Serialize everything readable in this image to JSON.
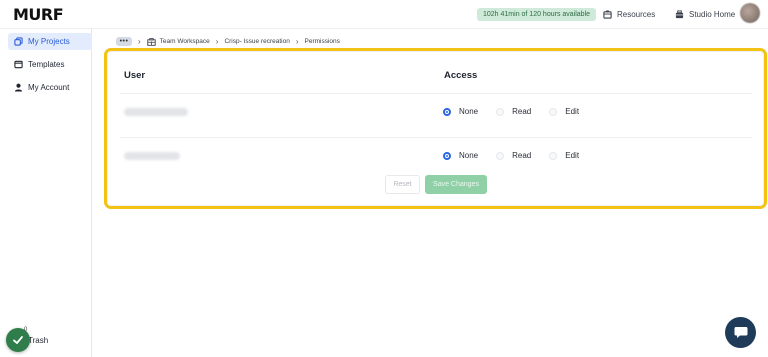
{
  "header": {
    "logo": "MURF",
    "hours_badge": "102h 41min of 120 hours available",
    "resources_label": "Resources",
    "studio_home_label": "Studio Home"
  },
  "sidebar": {
    "items": [
      {
        "label": "My Projects",
        "icon": "projects-icon",
        "active": true
      },
      {
        "label": "Templates",
        "icon": "templates-icon",
        "active": false
      },
      {
        "label": "My Account",
        "icon": "account-icon",
        "active": false
      }
    ],
    "trash_label": "Trash",
    "toast_count": "0"
  },
  "breadcrumb": {
    "more": "•••",
    "items": [
      "Team Workspace",
      "Crisp- Issue recreation",
      "Permissions"
    ]
  },
  "permissions": {
    "user_header": "User",
    "access_header": "Access",
    "options": [
      "None",
      "Read",
      "Edit"
    ],
    "rows": [
      {
        "selected": "None"
      },
      {
        "selected": "None"
      }
    ],
    "reset_label": "Reset",
    "save_label": "Save Changes"
  },
  "colors": {
    "highlight": "#f2c315",
    "accent": "#2b67e0",
    "save_button": "#8fd0a7",
    "chat_button": "#1f3b5a"
  }
}
